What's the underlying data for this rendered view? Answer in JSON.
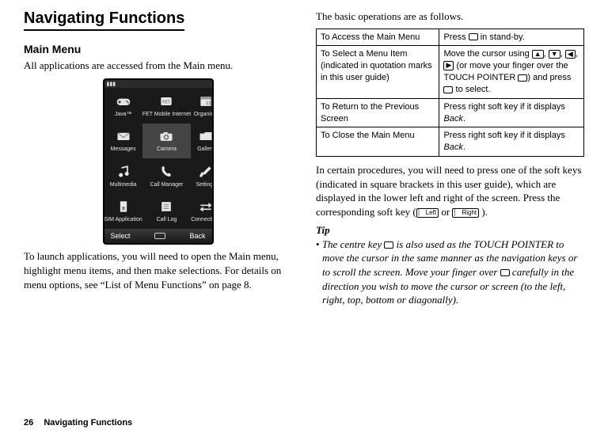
{
  "page": {
    "number": "26",
    "section": "Navigating Functions"
  },
  "left": {
    "h1": "Navigating Functions",
    "h2": "Main Menu",
    "intro": "All applications are accessed from the Main menu.",
    "launch_para": "To launch applications, you will need to open the Main menu, highlight menu items, and then make selections. For details on menu options, see “List of Menu Functions” on page 8.",
    "softkeys": {
      "left": "Select",
      "right": "Back"
    },
    "grid": [
      {
        "label": "Java™"
      },
      {
        "label": "FET Mobile Internet"
      },
      {
        "label": "Organiser"
      },
      {
        "label": "Messages"
      },
      {
        "label": "Camera"
      },
      {
        "label": "Gallery"
      },
      {
        "label": "Multimedia"
      },
      {
        "label": "Call Manager"
      },
      {
        "label": "Settings"
      },
      {
        "label": "SIM Application"
      },
      {
        "label": "Call Log"
      },
      {
        "label": "Connectivity"
      }
    ]
  },
  "right": {
    "intro": "The basic operations are as follows.",
    "table": [
      {
        "l": "To Access the Main Menu",
        "r_pre": "Press ",
        "r_post": " in stand-by."
      },
      {
        "l": "To Select a Menu Item (indicated in quotation marks in this user guide)",
        "r_pre": "Move the cursor using ",
        "r_mid": " (or move your finger over the TOUCH POINTER ",
        "r_mid2": ") and press ",
        "r_post": " to select."
      },
      {
        "l": "To Return to the Previous Screen",
        "r_pre": "Press right soft key if it displays ",
        "r_italic": "Back",
        "r_post": "."
      },
      {
        "l": "To Close the Main Menu",
        "r_pre": "Press right soft key if it displays ",
        "r_italic": "Back",
        "r_post": "."
      }
    ],
    "para_pre": "In certain procedures, you will need to press one of the soft keys (indicated in square brackets in this user guide), which are displayed in the lower left and right of the screen. Press the corresponding soft key (",
    "para_mid": " or ",
    "para_post": " ).",
    "softkey_left_label": "Left",
    "softkey_right_label": "Right",
    "tip_head": "Tip",
    "tip_pre": "The centre key ",
    "tip_post": " is also used as the TOUCH POINTER to move the cursor in the same manner as the navigation keys or to scroll the screen. Move your finger over ",
    "tip_post2": " carefully in the direction you wish to move the cursor or screen (to the left, right, top, bottom or diagonally)."
  }
}
